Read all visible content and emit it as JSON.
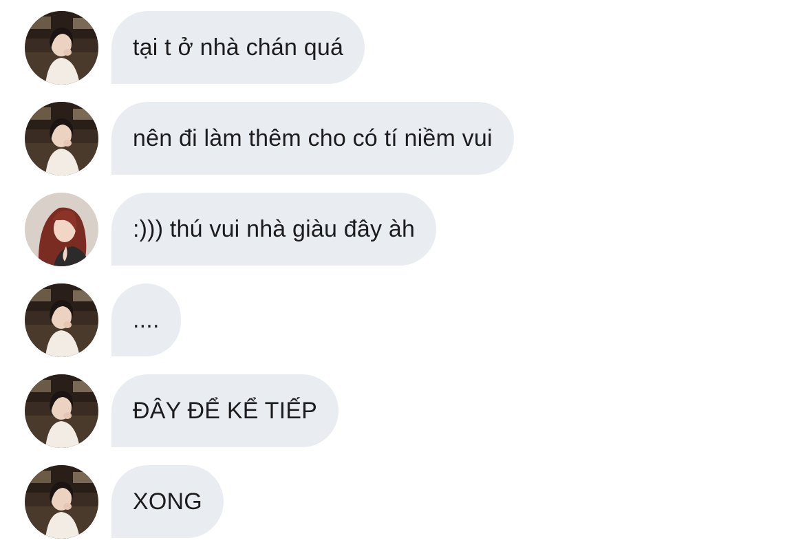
{
  "conversation": {
    "messages": [
      {
        "sender": "friend-a",
        "avatar": "avatar-friend-a",
        "text": "tại t ở nhà chán quá"
      },
      {
        "sender": "friend-a",
        "avatar": "avatar-friend-a",
        "text": "nên đi làm thêm cho có tí niềm vui"
      },
      {
        "sender": "friend-b",
        "avatar": "avatar-friend-b",
        "text": ":))) thú vui nhà giàu đây àh"
      },
      {
        "sender": "friend-a",
        "avatar": "avatar-friend-a",
        "text": "...."
      },
      {
        "sender": "friend-a",
        "avatar": "avatar-friend-a",
        "text": "ĐÂY ĐỂ KỂ TIẾP"
      },
      {
        "sender": "friend-a",
        "avatar": "avatar-friend-a",
        "text": "XONG"
      }
    ]
  },
  "colors": {
    "bubble_background": "#e9edf1",
    "text": "#1c1c1e",
    "page_background": "#ffffff"
  }
}
